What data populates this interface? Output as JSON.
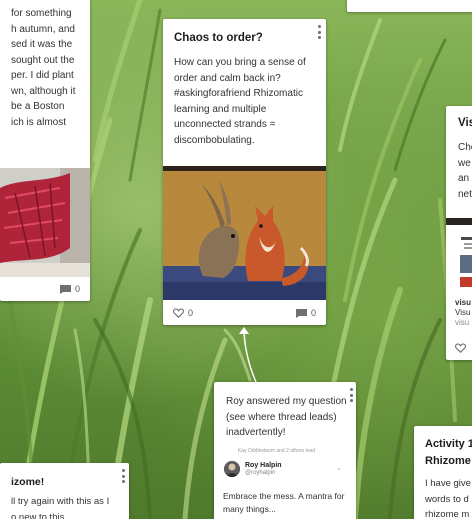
{
  "cards": {
    "left_partial": {
      "lines": [
        "for something",
        "h autumn, and",
        "sed it was the",
        "sought out the",
        "per. I did plant",
        "wn, although it",
        "be a Boston",
        "ich is almost"
      ],
      "comment_count": "0"
    },
    "main": {
      "title": "Chaos to order?",
      "body": "How can you bring a sense of order and calm back in? #askingforafriend Rhizomatic learning and multiple unconnected strands = discombobulating.",
      "like_count": "0",
      "comment_count": "0"
    },
    "right_partial": {
      "title": "Visu",
      "lines": [
        "Che",
        "we",
        "an",
        "net"
      ],
      "link_title": "visu",
      "link_desc": "Visu",
      "link_url": "visu"
    },
    "roy": {
      "body": "Roy answered my question (see where thread leads) inadvertently!",
      "embed_faded": "Kay Oddlestaum and 2 others lead",
      "embed_name": "Roy Halpin",
      "embed_handle": "@royhalpin",
      "embed_text": "Embrace the mess. A mantra for many things..."
    },
    "left_bottom": {
      "title": "izome!",
      "lines": [
        "ll try again with this as I",
        "o new to this"
      ]
    },
    "right_bottom": {
      "title_line1": "Activity 1",
      "title_line2": "Rhizome",
      "lines": [
        "I have give",
        "words to d",
        "rhizome m"
      ]
    }
  },
  "colors": {
    "card": "#ffffff",
    "title_text": "#1d1d1d",
    "body_text": "#333333",
    "icon_grey": "#6f6f6f"
  }
}
